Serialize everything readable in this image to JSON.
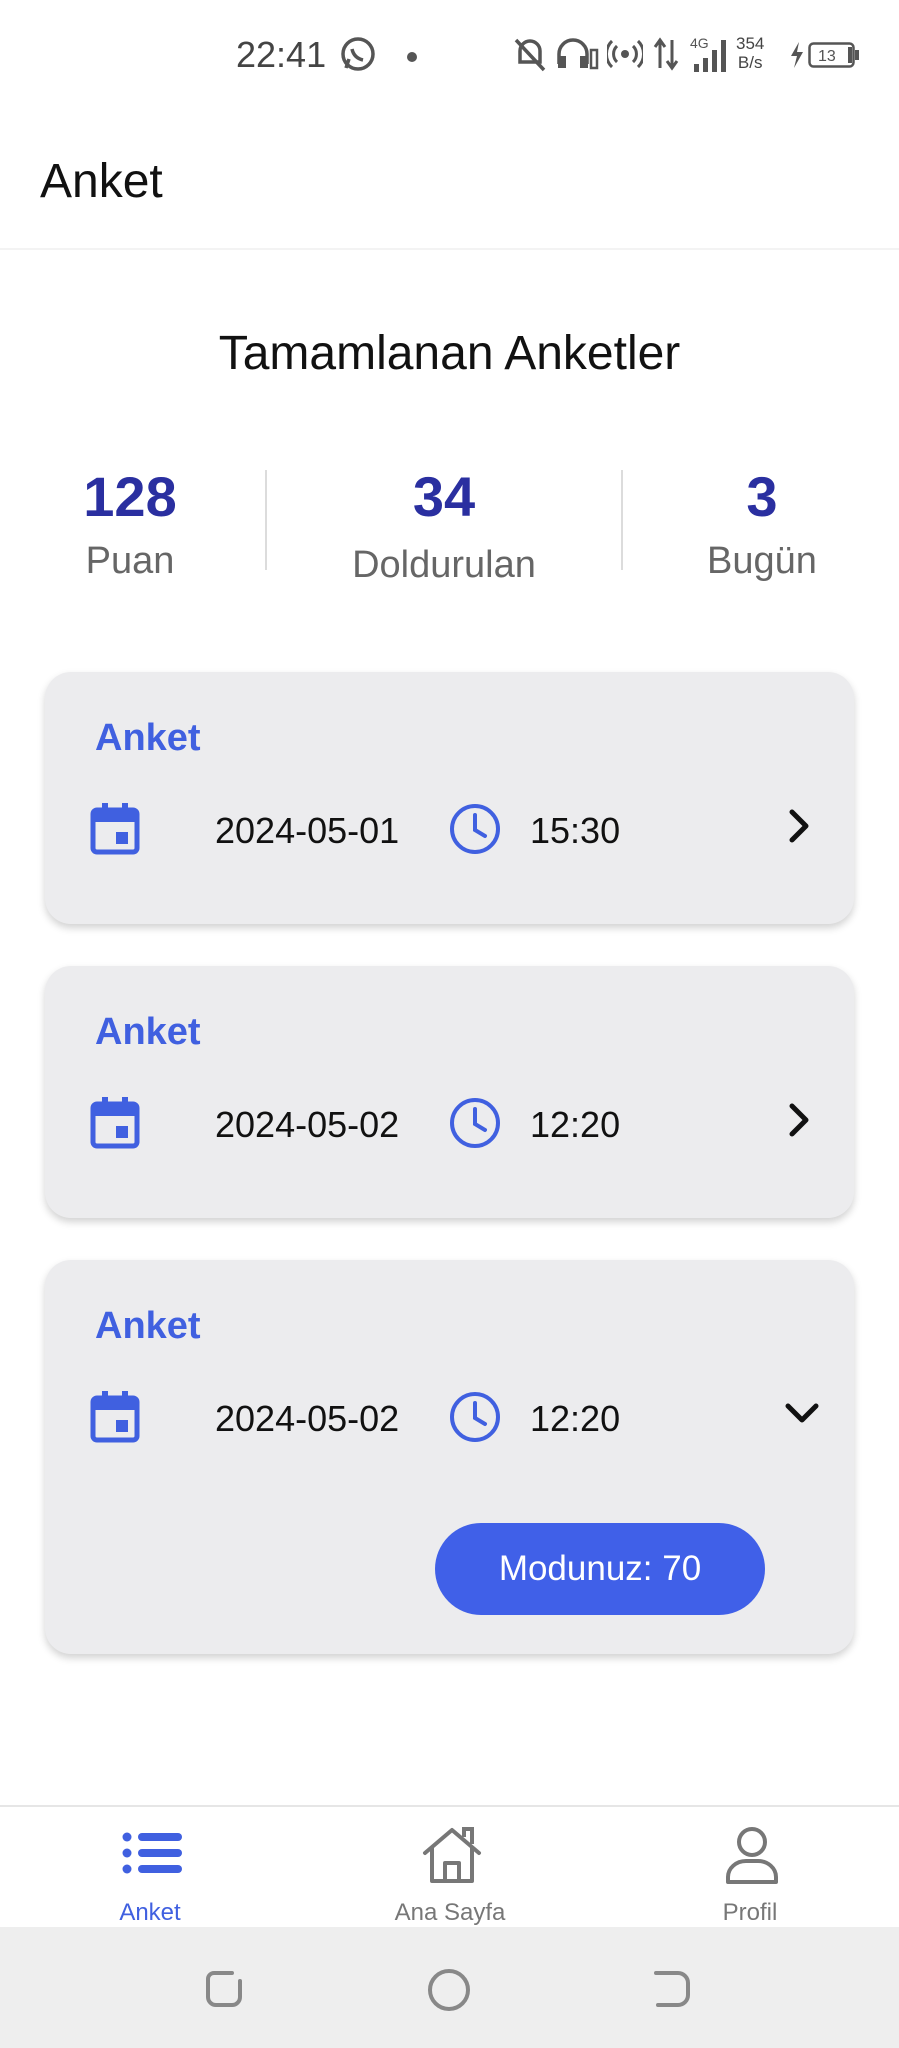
{
  "status_bar": {
    "time": "22:41",
    "net_speed_value": "354",
    "net_speed_unit": "B/s",
    "network_type": "4G",
    "battery": "13"
  },
  "app_bar": {
    "title": "Anket"
  },
  "section_title": "Tamamlanan Anketler",
  "stats": [
    {
      "value": "128",
      "label": "Puan"
    },
    {
      "value": "34",
      "label": "Doldurulan"
    },
    {
      "value": "3",
      "label": "Bugün"
    }
  ],
  "cards": [
    {
      "title": "Anket",
      "date": "2024-05-01",
      "time": "15:30",
      "expanded": false
    },
    {
      "title": "Anket",
      "date": "2024-05-02",
      "time": "12:20",
      "expanded": false
    },
    {
      "title": "Anket",
      "date": "2024-05-02",
      "time": "12:20",
      "expanded": true,
      "score_label": "Modunuz: 70"
    }
  ],
  "bottom_nav": [
    {
      "label": "Anket",
      "icon": "list-icon",
      "active": true
    },
    {
      "label": "Ana Sayfa",
      "icon": "home-icon",
      "active": false
    },
    {
      "label": "Profil",
      "icon": "person-icon",
      "active": false
    }
  ],
  "colors": {
    "accent": "#4060e0",
    "stat_value": "#2a2fa0",
    "card_bg": "#ececee"
  }
}
